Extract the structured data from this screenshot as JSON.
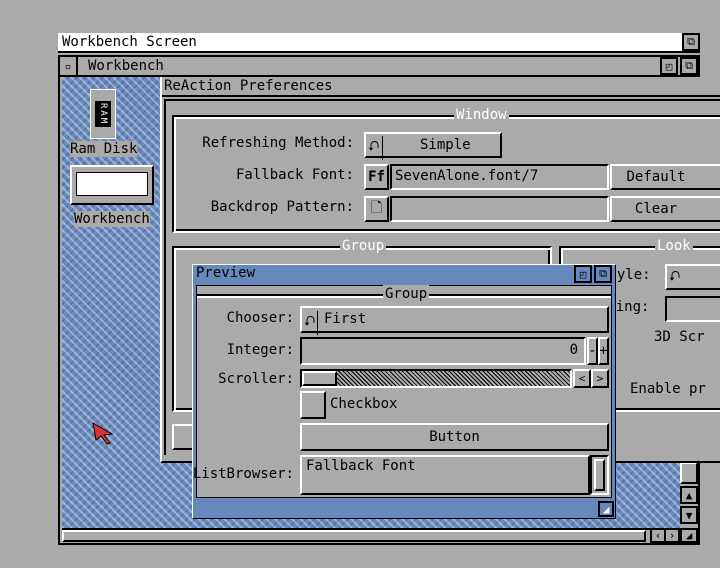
{
  "screen": {
    "title": "Workbench Screen"
  },
  "workbench": {
    "title": "Workbench",
    "icons": [
      {
        "label": "Ram Disk",
        "glyph": "RAM"
      },
      {
        "label": "Workbench"
      }
    ]
  },
  "prefs": {
    "title": "ReAction Preferences",
    "window_group": {
      "title": "Window",
      "refresh_label": "Refreshing Method:",
      "refresh_value": "Simple",
      "font_label": "Fallback Font:",
      "font_icon": "Ff",
      "font_value": "SevenAlone.font/7",
      "default_btn": "Default",
      "backdrop_label": "Backdrop Pattern:",
      "backdrop_value": "",
      "clear_btn": "Clear"
    },
    "group_title": "Group",
    "look": {
      "title": "Look",
      "style_label": "Style:",
      "spacing_label": "Spacing:",
      "screen3d": "3D Scr",
      "enable": "Enable pr"
    }
  },
  "preview": {
    "title": "Preview",
    "group_title": "Group",
    "chooser_label": "Chooser:",
    "chooser_value": "First",
    "integer_label": "Integer:",
    "integer_value": "0",
    "minus": "-",
    "plus": "+",
    "scroller_label": "Scroller:",
    "scroller_position": 0.1,
    "left": "<",
    "right": ">",
    "checkbox_label": "Checkbox",
    "checkbox_checked": false,
    "button_label": "Button",
    "listbrowser_label": "ListBrowser:",
    "list_items": [
      "Fallback Font"
    ]
  },
  "colors": {
    "accent": "#6688bb",
    "gray": "#aaaaaa"
  }
}
